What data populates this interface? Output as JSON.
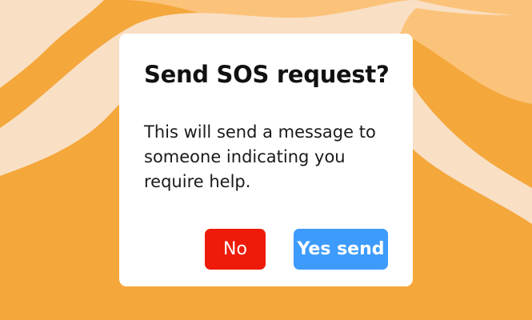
{
  "dialog": {
    "title": "Send SOS request?",
    "message": "This will send a message to someone indicating you require help.",
    "no_label": "No",
    "yes_label": "Yes send"
  },
  "colors": {
    "background": "#f4a73a",
    "background_wave_light": "#f9dfc4",
    "background_wave_mid": "#fbc37a",
    "dialog_background": "#ffffff",
    "no_button": "#ee1a0a",
    "yes_button": "#3d9bfb"
  }
}
